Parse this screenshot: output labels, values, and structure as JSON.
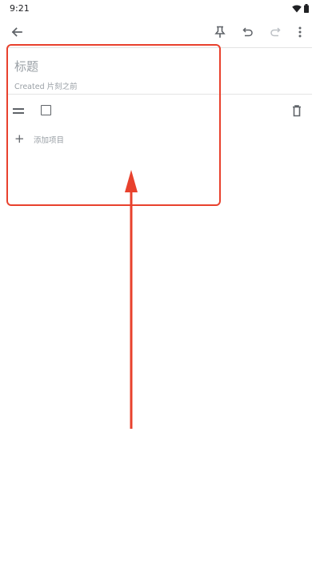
{
  "status": {
    "time": "9:21",
    "icons": [
      "wifi-icon",
      "battery-icon"
    ]
  },
  "toolbar": {
    "icons": [
      "back-arrow-icon",
      "pin-icon",
      "undo-icon",
      "redo-icon",
      "more-vert-icon"
    ]
  },
  "note": {
    "title_placeholder": "标题",
    "created_text": "Created 片刻之前",
    "items": [
      {
        "checked": false,
        "text": ""
      }
    ],
    "add_item_label": "添加项目"
  },
  "annotation": {
    "color": "#e8412d"
  }
}
